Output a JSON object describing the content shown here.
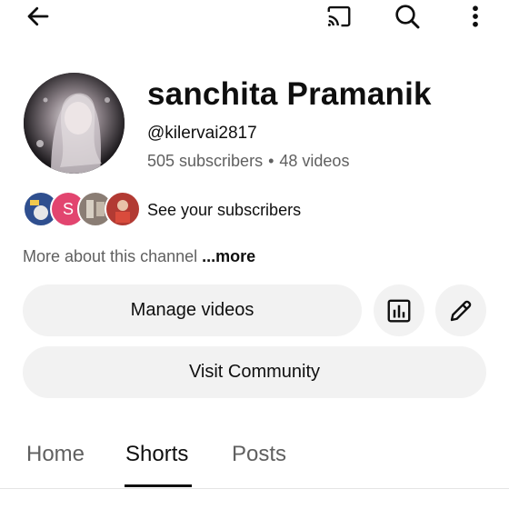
{
  "header": {
    "back_icon": "arrow-left-icon",
    "cast_icon": "cast-icon",
    "search_icon": "search-icon",
    "more_icon": "more-vert-icon"
  },
  "channel": {
    "name": "sanchita Pramanik",
    "handle": "@kilervai2817",
    "subscribers": "505 subscribers",
    "separator": "•",
    "videos": "48 videos"
  },
  "subscribers_row": {
    "label": "See your subscribers",
    "avatars": [
      {
        "initial": "",
        "color": "#2f4f8f"
      },
      {
        "initial": "S",
        "color": "#e2456f"
      },
      {
        "initial": "",
        "color": "#8a7d74"
      },
      {
        "initial": "",
        "color": "#b23a33"
      }
    ]
  },
  "about": {
    "text": "More about this channel",
    "more": "...more"
  },
  "buttons": {
    "manage_videos": "Manage videos",
    "analytics_icon": "bar-chart-icon",
    "edit_icon": "pencil-icon",
    "visit_community": "Visit Community"
  },
  "tabs": [
    {
      "label": "Home"
    },
    {
      "label": "Shorts"
    },
    {
      "label": "Posts"
    }
  ]
}
